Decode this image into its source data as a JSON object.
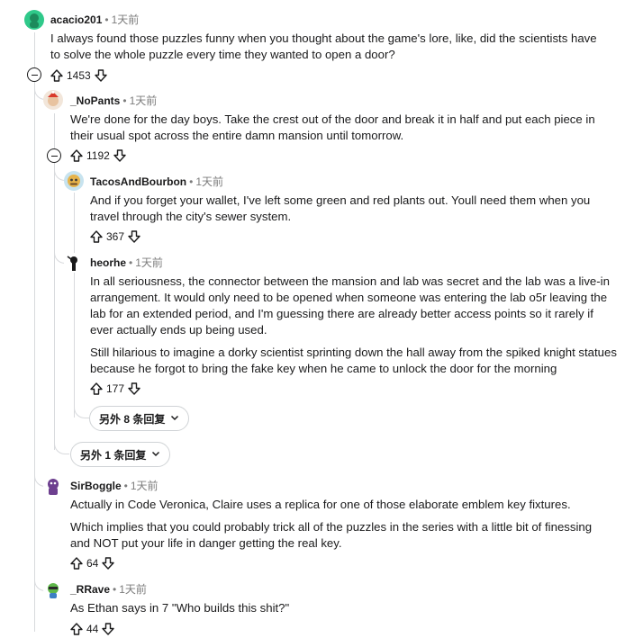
{
  "comments": [
    {
      "user": "acacio201",
      "time": "1天前",
      "paragraphs": [
        "I always found those puzzles funny when you thought about the game's lore, like, did the scientists have to solve the whole puzzle every time they wanted to open a door?"
      ],
      "votes": "1453"
    },
    {
      "user": "_NoPants",
      "time": "1天前",
      "paragraphs": [
        "We're done for the day boys. Take the crest out of the door and break it in half and put each piece in their usual spot across the entire damn mansion until tomorrow."
      ],
      "votes": "1192"
    },
    {
      "user": "TacosAndBourbon",
      "time": "1天前",
      "paragraphs": [
        "And if you forget your wallet, I've left some green and red plants out. Youll need them when you travel through the city's sewer system."
      ],
      "votes": "367"
    },
    {
      "user": "heorhe",
      "time": "1天前",
      "paragraphs": [
        "In all seriousness, the connector between the mansion and lab was secret and the lab was a live-in arrangement. It would only need to be opened when someone was entering the lab o5r leaving the lab for an extended period, and I'm guessing there are already better access points so it rarely if ever actually ends up being used.",
        "Still hilarious to imagine a dorky scientist sprinting down the hall away from the spiked knight statues because he forgot to bring the fake key when he came to unlock the door for the morning"
      ],
      "votes": "177"
    },
    {
      "user": "SirBoggle",
      "time": "1天前",
      "paragraphs": [
        "Actually in Code Veronica, Claire uses a replica for one of those elaborate emblem key fixtures.",
        "Which implies that you could probably trick all of the puzzles in the series with a little bit of finessing and NOT put your life in danger getting the real key."
      ],
      "votes": "64"
    },
    {
      "user": "_RRave",
      "time": "1天前",
      "paragraphs": [
        "As Ethan says in 7 \"Who builds this shit?\""
      ],
      "votes": "44"
    }
  ],
  "more_replies": [
    {
      "label": "另外 8 条回复"
    },
    {
      "label": "另外 1 条回复"
    }
  ],
  "colors": {
    "accent_green": "#2fc98a",
    "thread_line": "#d8dadd",
    "meta_gray": "#7c7c7c"
  },
  "icons": [
    "upvote-icon",
    "downvote-icon",
    "collapse-icon",
    "chevron-down-icon"
  ]
}
